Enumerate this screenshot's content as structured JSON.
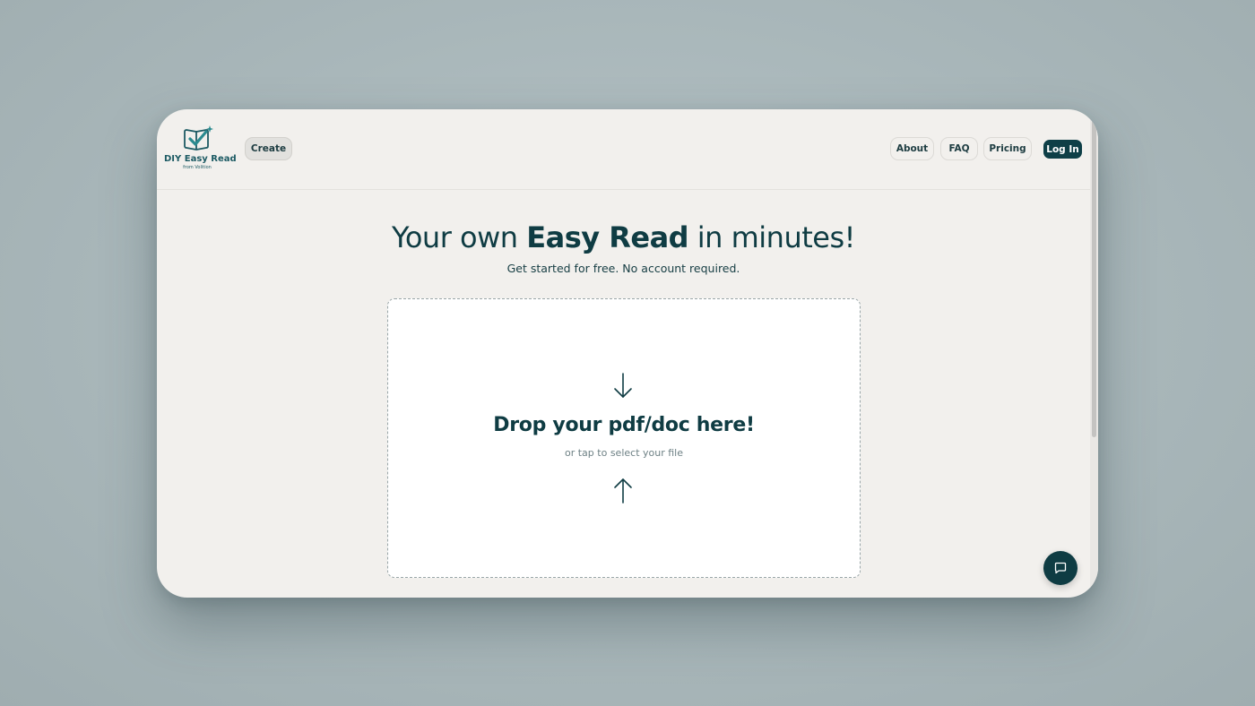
{
  "brand": {
    "name": "DIY Easy Read",
    "tagline": "from Volition",
    "logo_icon": "book-checkmark-sparkle-icon",
    "accent_color": "#1c5a63"
  },
  "nav": {
    "create_label": "Create",
    "about_label": "About",
    "faq_label": "FAQ",
    "pricing_label": "Pricing",
    "login_label": "Log In"
  },
  "hero": {
    "title_pre": "Your own ",
    "title_bold": "Easy Read",
    "title_post": " in minutes!",
    "subtitle": "Get started for free. No account required."
  },
  "dropzone": {
    "title": "Drop your pdf/doc here!",
    "subtitle": "or tap to select your file",
    "icon_top": "arrow-down-icon",
    "icon_bottom": "arrow-up-icon"
  },
  "chat": {
    "icon": "chat-bubble-icon",
    "color": "#0f3c43"
  },
  "colors": {
    "primary_dark": "#0f3c43",
    "background": "#f2f0ed",
    "dropzone_bg": "#ffffff"
  }
}
